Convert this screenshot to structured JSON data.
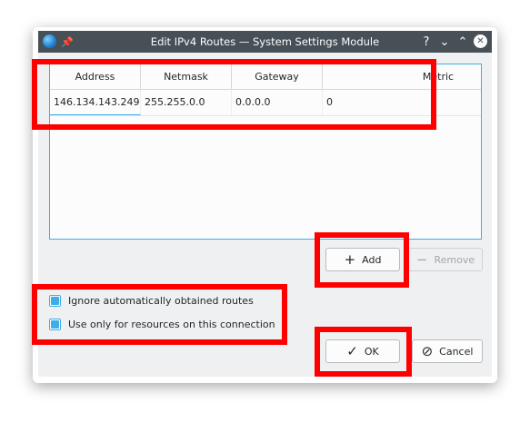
{
  "window": {
    "title": "Edit IPv4 Routes — System Settings Module"
  },
  "titlebar_buttons": {
    "help": "?",
    "minimize": "⌄",
    "maximize": "⌃",
    "close": "✕"
  },
  "table": {
    "columns": [
      "Address",
      "Netmask",
      "Gateway",
      "Metric"
    ],
    "rows": [
      [
        "146.134.143.249",
        "255.255.0.0",
        "0.0.0.0",
        "0"
      ]
    ]
  },
  "buttons": {
    "add": "Add",
    "remove": "Remove",
    "ok": "OK",
    "cancel": "Cancel"
  },
  "checkboxes": [
    {
      "label": "Ignore automatically obtained routes",
      "checked": true
    },
    {
      "label": "Use only for resources on this connection",
      "checked": true
    }
  ],
  "colors": {
    "accent": "#3daee9",
    "titlebar": "#475057",
    "highlight": "#ff0000"
  }
}
